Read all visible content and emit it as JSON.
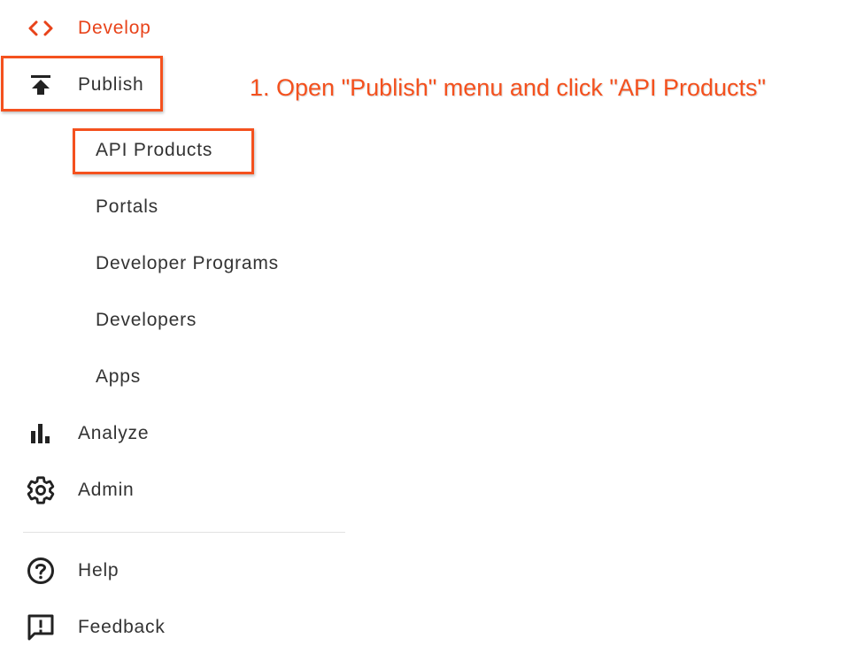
{
  "nav": {
    "develop": {
      "label": "Develop",
      "icon": "code-brackets-icon"
    },
    "publish": {
      "label": "Publish",
      "icon": "publish-icon",
      "children": [
        {
          "label": "API Products"
        },
        {
          "label": "Portals"
        },
        {
          "label": "Developer Programs"
        },
        {
          "label": "Developers"
        },
        {
          "label": "Apps"
        }
      ]
    },
    "analyze": {
      "label": "Analyze",
      "icon": "bar-chart-icon"
    },
    "admin": {
      "label": "Admin",
      "icon": "gear-icon"
    },
    "help": {
      "label": "Help",
      "icon": "help-circle-icon"
    },
    "feedback": {
      "label": "Feedback",
      "icon": "feedback-icon"
    }
  },
  "annotation": {
    "text": "1. Open \"Publish\" menu and click \"API Products\"",
    "color": "#f4511e"
  },
  "colors": {
    "active": "#e8431a",
    "text": "#333333",
    "icon": "#222222",
    "highlight": "#f4511e"
  }
}
